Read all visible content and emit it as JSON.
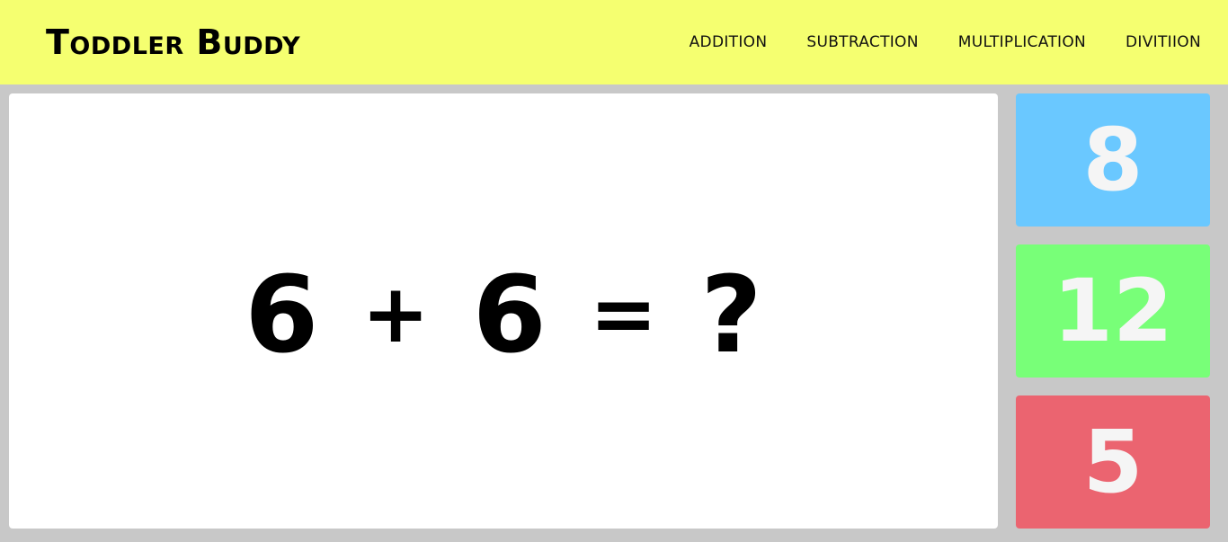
{
  "header": {
    "logo": "Toddler Buddy",
    "nav": [
      "ADDITION",
      "SUBTRACTION",
      "MULTIPLICATION",
      "DIVITIION"
    ]
  },
  "question": {
    "operand1": "6",
    "operator": "+",
    "operand2": "6",
    "equals": "=",
    "unknown": "?"
  },
  "answers": [
    {
      "label": "8",
      "color": "#6ac8ff"
    },
    {
      "label": "12",
      "color": "#78ff78"
    },
    {
      "label": "5",
      "color": "#eb6470"
    }
  ],
  "colors": {
    "header_bg": "#f5ff70",
    "page_bg": "#c8c8c8",
    "panel_bg": "#ffffff",
    "answer_text": "#f5f5f5"
  }
}
